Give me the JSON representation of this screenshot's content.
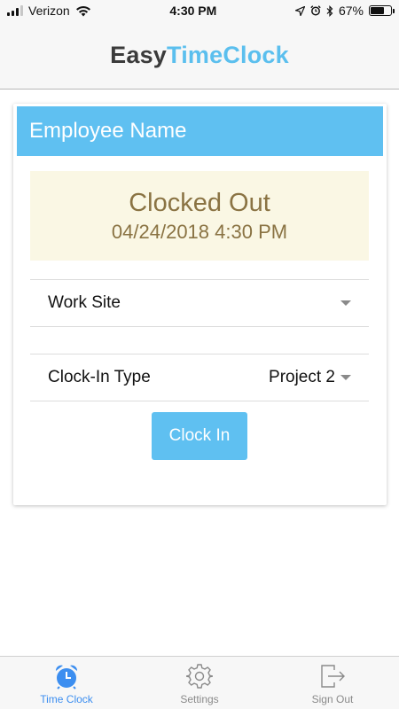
{
  "status_bar": {
    "carrier": "Verizon",
    "time": "4:30 PM",
    "battery": "67%",
    "battery_level": 0.67
  },
  "header": {
    "logo_part1": "Easy",
    "logo_part2": "TimeClock"
  },
  "card": {
    "title": "Employee Name",
    "status": {
      "title": "Clocked Out",
      "timestamp": "04/24/2018 4:30 PM"
    },
    "work_site": {
      "label": "Work Site",
      "value": ""
    },
    "clock_in_type": {
      "label": "Clock-In Type",
      "value": "Project 2"
    },
    "button_label": "Clock In"
  },
  "tabs": [
    {
      "label": "Time Clock",
      "icon": "alarm-clock-icon",
      "active": true
    },
    {
      "label": "Settings",
      "icon": "gear-icon",
      "active": false
    },
    {
      "label": "Sign Out",
      "icon": "sign-out-icon",
      "active": false
    }
  ],
  "colors": {
    "accent": "#5fc0f1",
    "active_tab": "#3c8ef0",
    "status_bg": "#faf7e4",
    "status_text": "#8a7343"
  }
}
